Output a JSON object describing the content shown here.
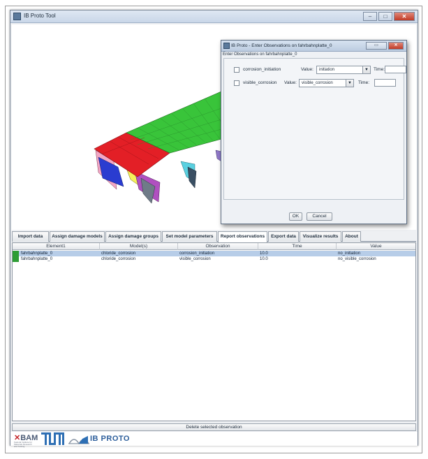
{
  "window": {
    "title": "IB Proto Tool"
  },
  "tabs": [
    {
      "label": "Import data"
    },
    {
      "label": "Assign damage models"
    },
    {
      "label": "Assign damage groups"
    },
    {
      "label": "Set model parameters"
    },
    {
      "label": "Report observations"
    },
    {
      "label": "Export data"
    },
    {
      "label": "Visualize results"
    },
    {
      "label": "About"
    }
  ],
  "table": {
    "headers": [
      "Element1",
      "Model(s)",
      "Observation",
      "Time",
      "Value"
    ],
    "rows": [
      {
        "element": "fahrbahnplatte_0",
        "models": "chloride_corrosion",
        "observation": "corrosion_initiation",
        "time": "10.0",
        "value": "no_initiation"
      },
      {
        "element": "fahrbahnplatte_0",
        "models": "chloride_corrosion",
        "observation": "visible_corrosion",
        "time": "10.0",
        "value": "no_visible_corrosion"
      }
    ]
  },
  "delete_button": "Delete selected observation",
  "logos": {
    "bam": "BAM",
    "bam_sub": "Federal Institute for Materials Research and Testing",
    "proto": "IB PROTO"
  },
  "dialog": {
    "title": "IB Proto - Enter Observations on fahrbahnplatte_0",
    "subtitle": "Enter Observations on fahrbahnplatte_0",
    "rows": [
      {
        "name": "corrosion_initiation",
        "value_label": "Value:",
        "value": "initiation",
        "time_label": "Time:",
        "time": ""
      },
      {
        "name": "visible_corrosion",
        "value_label": "Value:",
        "value": "visible_corrosion",
        "time_label": "Time:",
        "time": ""
      }
    ],
    "ok": "OK",
    "cancel": "Cancel"
  },
  "colors": {
    "selected_row": "#b7cde8",
    "deck_red": "#e31f26",
    "deck_green": "#39c43a",
    "accent_blue": "#2e6fb4"
  }
}
